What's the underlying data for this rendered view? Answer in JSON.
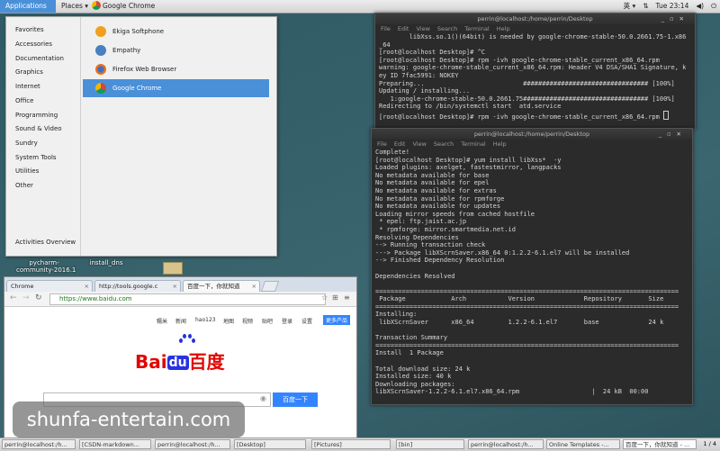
{
  "top_panel": {
    "applications": "Applications ▾",
    "places": "Places ▾",
    "active_app": "Google Chrome",
    "input_method": "英 ▾",
    "clock": "Tue 23:14",
    "tray_icons": [
      "network-icon",
      "volume-icon",
      "power-icon"
    ]
  },
  "apps_menu": {
    "categories": [
      "Favorites",
      "Accessories",
      "Documentation",
      "Graphics",
      "Internet",
      "Office",
      "Programming",
      "Sound & Video",
      "Sundry",
      "System Tools",
      "Utilities",
      "Other"
    ],
    "apps": [
      "Ekiga Softphone",
      "Empathy",
      "Firefox Web Browser",
      "Google Chrome"
    ],
    "activities_overview": "Activities Overview"
  },
  "desktop": {
    "icon1": "pycharm-\ncommunity-2016.1",
    "icon2": "install_dns"
  },
  "term1": {
    "title": "perrin@localhost:/home/perrin/Desktop",
    "menu": [
      "File",
      "Edit",
      "View",
      "Search",
      "Terminal",
      "Help"
    ],
    "lines": [
      "        libXss.so.1()(64bit) is needed by google-chrome-stable-50.0.2661.75-1.x86",
      "_64",
      "[root@localhost Desktop]# ^C",
      "[root@localhost Desktop]# rpm -ivh google-chrome-stable_current_x86_64.rpm",
      "warning: google-chrome-stable_current_x86_64.rpm: Header V4 DSA/SHA1 Signature, k",
      "ey ID 7fac5991: NOKEY",
      "Preparing...                          ################################# [100%]",
      "Updating / installing...",
      "   1:google-chrome-stable-50.0.2661.75################################# [100%]",
      "Redirecting to /bin/systemctl start  atd.service",
      "[root@localhost Desktop]# rpm -ivh google-chrome-stable_current_x86_64.rpm "
    ]
  },
  "term2": {
    "title": "perrin@localhost:/home/perrin/Desktop",
    "menu": [
      "File",
      "Edit",
      "View",
      "Search",
      "Terminal",
      "Help"
    ],
    "lines": [
      "Complete!",
      "[root@localhost Desktop]# yum install libXss*  -y",
      "Loaded plugins: axelget, fastestmirror, langpacks",
      "No metadata available for base",
      "No metadata available for epel",
      "No metadata available for extras",
      "No metadata available for rpmforge",
      "No metadata available for updates",
      "Loading mirror speeds from cached hostfile",
      " * epel: ftp.jaist.ac.jp",
      " * rpmforge: mirror.smartmedia.net.id",
      "Resolving Dependencies",
      "--> Running transaction check",
      "---> Package libXScrnSaver.x86_64 0:1.2.2-6.1.el7 will be installed",
      "--> Finished Dependency Resolution",
      "",
      "Dependencies Resolved",
      "",
      "================================================================================",
      " Package            Arch           Version             Repository       Size",
      "================================================================================",
      "Installing:",
      " libXScrnSaver      x86_64         1.2.2-6.1.el7       base             24 k",
      "",
      "Transaction Summary",
      "================================================================================",
      "Install  1 Package",
      "",
      "Total download size: 24 k",
      "Installed size: 40 k",
      "Downloading packages:",
      "libXScrnSaver-1.2.2-6.1.el7.x86_64.rpm                   |  24 kB  00:00"
    ]
  },
  "chrome": {
    "tabs": [
      "Chrome",
      "http://tools.google.c",
      "百度一下，你就知道"
    ],
    "url": "https://www.baidu.com",
    "nav": [
      "糯米",
      "新闻",
      "hao123",
      "地图",
      "视频",
      "贴吧",
      "登录",
      "设置"
    ],
    "more_products": "更多产品",
    "logo_bai": "Bai",
    "logo_du": "du",
    "logo_cn": "百度",
    "search_button": "百度一下"
  },
  "taskbar": {
    "items": [
      "perrin@localhost:/h...",
      "[CSDN-markdown...",
      "perrin@localhost:/h...",
      "[Desktop]",
      "[Pictures]",
      "[bin]",
      "perrin@localhost:/h...",
      "Online Templates -...",
      "百度一下，你就知道 - ..."
    ],
    "workspace": "1 / 4"
  },
  "watermark": "shunfa-entertain.com"
}
